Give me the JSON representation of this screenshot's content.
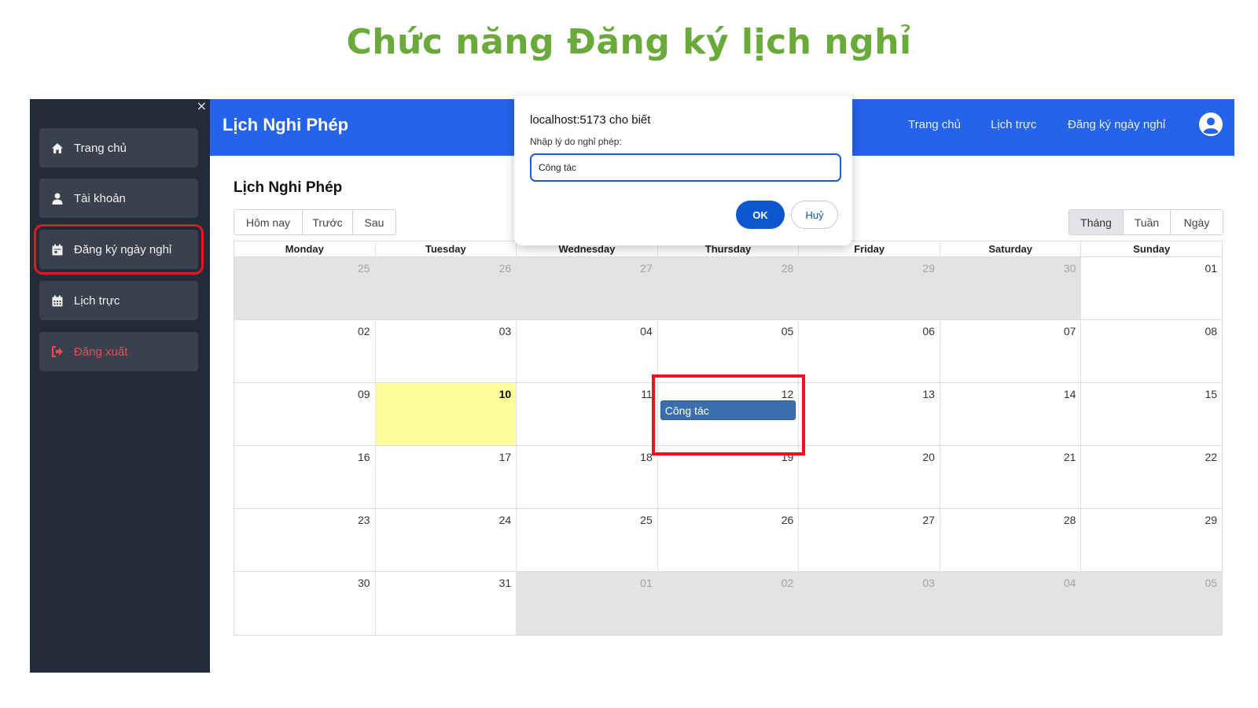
{
  "slide_title": "Chức năng Đăng ký lịch nghỉ",
  "sidebar": {
    "close_symbol": "×",
    "items": [
      {
        "label": "Trang chủ",
        "icon": "home-icon"
      },
      {
        "label": "Tài khoản",
        "icon": "user-icon"
      },
      {
        "label": "Đăng ký ngày nghỉ",
        "icon": "calendar-icon",
        "active": true
      },
      {
        "label": "Lịch trực",
        "icon": "calendar-grid-icon"
      },
      {
        "label": "Đăng xuất",
        "icon": "sign-out-icon",
        "color": "#ef4a55"
      }
    ]
  },
  "header": {
    "brand": "Lịch Nghi Phép",
    "nav": [
      "Trang chủ",
      "Lịch trực",
      "Đăng ký ngày nghỉ"
    ],
    "color": "#2563eb"
  },
  "content": {
    "title": "Lịch Nghi Phép",
    "nav_buttons": [
      "Hôm nay",
      "Trước",
      "Sau"
    ],
    "view_buttons": [
      "Tháng",
      "Tuần",
      "Ngày"
    ],
    "selected_view": "Tháng"
  },
  "calendar": {
    "headers": [
      "Monday",
      "Tuesday",
      "Wednesday",
      "Thursday",
      "Friday",
      "Saturday",
      "Sunday"
    ],
    "weeks": [
      [
        "25",
        "26",
        "27",
        "28",
        "29",
        "30",
        "01"
      ],
      [
        "02",
        "03",
        "04",
        "05",
        "06",
        "07",
        "08"
      ],
      [
        "09",
        "10",
        "11",
        "12",
        "13",
        "14",
        "15"
      ],
      [
        "16",
        "17",
        "18",
        "19",
        "20",
        "21",
        "22"
      ],
      [
        "23",
        "24",
        "25",
        "26",
        "27",
        "28",
        "29"
      ],
      [
        "30",
        "31",
        "01",
        "02",
        "03",
        "04",
        "05"
      ]
    ],
    "today": "10",
    "event": {
      "label": "Công tác",
      "day": "12",
      "color": "#3a6fad"
    }
  },
  "dialog": {
    "title": "localhost:5173 cho biết",
    "message": "Nhập lý do nghỉ phép:",
    "input_value": "Công tác",
    "ok_label": "OK",
    "cancel_label": "Huỷ"
  }
}
